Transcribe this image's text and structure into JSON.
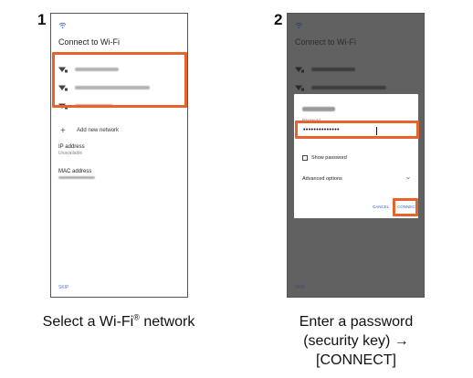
{
  "colors": {
    "highlight": "#e8632c",
    "screen_dim": "#616161",
    "link_blue": "#3b68c7"
  },
  "step1": {
    "number": "1",
    "screen": {
      "title": "Connect to Wi-Fi",
      "add_network_label": "Add new network",
      "ip_address_label": "IP address",
      "ip_address_value": "Unavailable",
      "mac_address_label": "MAC address",
      "skip_label": "SKIP"
    },
    "caption": {
      "text_before": "Select a Wi-Fi",
      "registered_mark": "®",
      "text_after": " network"
    }
  },
  "step2": {
    "number": "2",
    "screen": {
      "title": "Connect to Wi-Fi",
      "skip_label": "SKIP"
    },
    "dialog": {
      "password_label": "Password",
      "password_value": "••••••••••••••",
      "show_password_label": "Show password",
      "advanced_options_label": "Advanced options",
      "cancel_label": "CANCEL",
      "connect_label": "CONNECT"
    },
    "caption": {
      "line1": "Enter a password",
      "line2": "(security key) →",
      "line3": "[CONNECT]"
    }
  },
  "icons": {
    "wifi": "wifi-icon",
    "wifi_locked": "wifi-lock-icon",
    "plus": "plus-icon",
    "chevron": "chevron-down-icon"
  }
}
